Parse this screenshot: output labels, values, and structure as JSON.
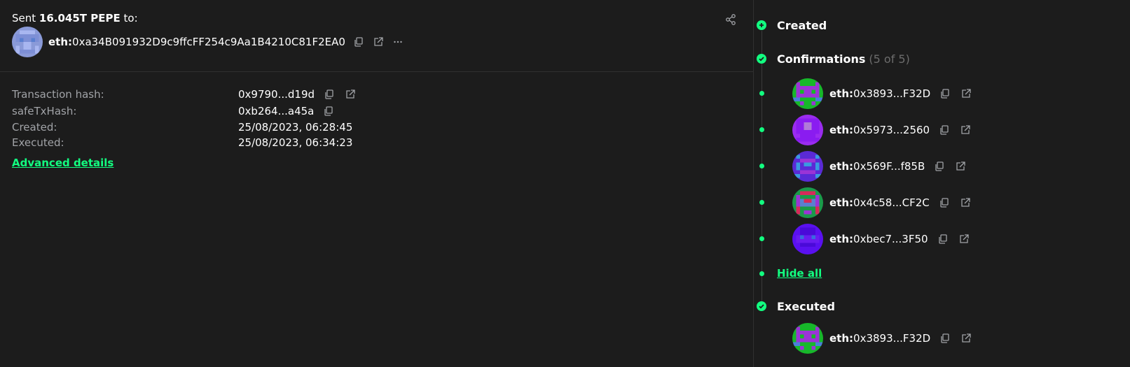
{
  "summary": {
    "sent_prefix": "Sent",
    "amount": "16.045T PEPE",
    "sent_suffix": "to:",
    "recipient_prefix": "eth:",
    "recipient_address": "0xa34B091932D9c9ffcFF254c9Aa1B4210C81F2EA0"
  },
  "details": {
    "rows": [
      {
        "label": "Transaction hash:",
        "value": "0x9790...d19d"
      },
      {
        "label": "safeTxHash:",
        "value": "0xb264...a45a"
      },
      {
        "label": "Created:",
        "value": "25/08/2023, 06:28:45"
      },
      {
        "label": "Executed:",
        "value": "25/08/2023, 06:34:23"
      }
    ],
    "advanced_link": "Advanced details"
  },
  "timeline": {
    "created_label": "Created",
    "confirmations_label": "Confirmations",
    "confirmations_count": "(5 of 5)",
    "owners": [
      {
        "prefix": "eth:",
        "address": "0x3893...F32D"
      },
      {
        "prefix": "eth:",
        "address": "0x5973...2560"
      },
      {
        "prefix": "eth:",
        "address": "0x569F...f85B"
      },
      {
        "prefix": "eth:",
        "address": "0x4c58...CF2C"
      },
      {
        "prefix": "eth:",
        "address": "0xbec7...3F50"
      }
    ],
    "hide_all": "Hide all",
    "executed_label": "Executed",
    "executor": {
      "prefix": "eth:",
      "address": "0x3893...F32D"
    }
  },
  "colors": {
    "background": "#1c1c1c",
    "accent": "#12ff80",
    "muted_text": "#a1a3a7",
    "divider": "#303030"
  },
  "icons": [
    "share-icon",
    "copy-icon",
    "external-link-icon",
    "more-icon",
    "plus-icon",
    "check-icon"
  ]
}
